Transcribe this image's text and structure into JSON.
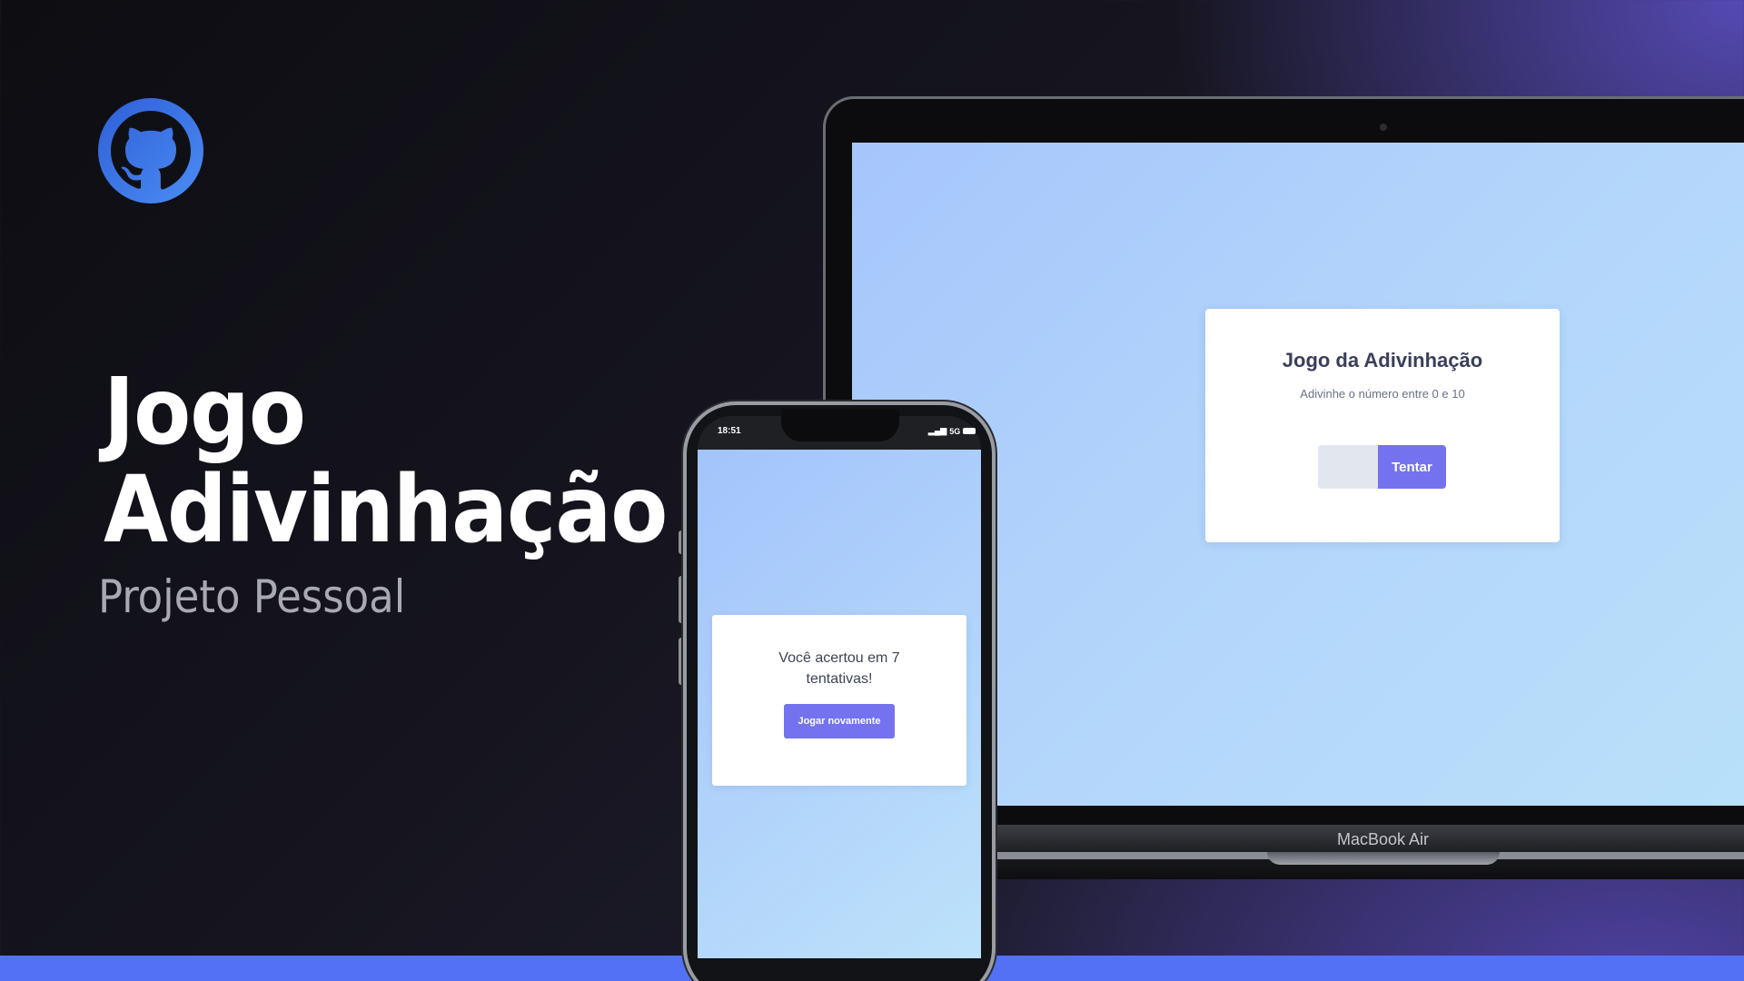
{
  "hero": {
    "title_line1": "Jogo",
    "title_line2": "Adivinhação",
    "subtitle": "Projeto Pessoal",
    "logo_icon": "github-icon"
  },
  "laptop": {
    "brand": "MacBook Air",
    "card": {
      "title": "Jogo da Adivinhação",
      "subtitle": "Adivinhe o número entre 0 e 10",
      "input_value": "",
      "button_label": "Tentar"
    }
  },
  "phone": {
    "time": "18:51",
    "network": "5G",
    "card": {
      "message": "Você acertou em 7 tentativas!",
      "button_label": "Jogar novamente"
    }
  },
  "colors": {
    "accent": "#7472ee",
    "bottom_bar": "#5271f5",
    "logo_blue": "#3b82f6"
  }
}
